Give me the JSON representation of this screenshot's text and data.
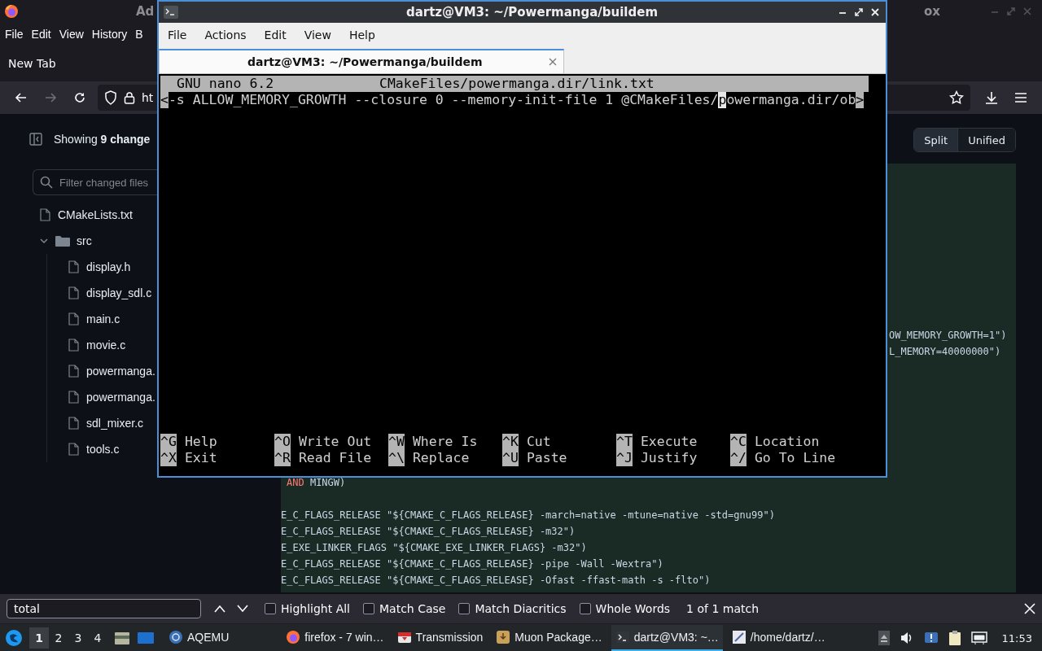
{
  "browser": {
    "title_left": "Ad",
    "title_right": "ox",
    "menu": [
      "File",
      "Edit",
      "View",
      "History",
      "B"
    ],
    "tab": "New Tab",
    "url": "ht"
  },
  "sidebar": {
    "summary": "Showing **9 change**",
    "filter": {
      "placeholder": "Filter changed files"
    },
    "tree": [
      {
        "kind": "file",
        "name": "CMakeLists.txt"
      },
      {
        "kind": "folder",
        "name": "src",
        "expanded": true,
        "children": [
          {
            "kind": "file",
            "name": "display.h"
          },
          {
            "kind": "file",
            "name": "display_sdl.c"
          },
          {
            "kind": "file",
            "name": "main.c"
          },
          {
            "kind": "file",
            "name": "movie.c"
          },
          {
            "kind": "file",
            "name": "powermanga."
          },
          {
            "kind": "file",
            "name": "powermanga."
          },
          {
            "kind": "file",
            "name": "sdl_mixer.c"
          },
          {
            "kind": "file",
            "name": "tools.c"
          }
        ]
      }
    ]
  },
  "view_toggle": [
    {
      "label": "Split",
      "selected": true
    },
    {
      "label": "Unified",
      "selected": false
    }
  ],
  "code": {
    "blocks": [
      [
        [
          {
            "kind": "plain",
            "text": "OW_MEMORY_GROWTH=1\")"
          }
        ],
        [
          {
            "kind": "plain",
            "text": "L_MEMORY=40000000\")"
          }
        ]
      ],
      [
        [
          {
            "kind": "keyword",
            "text": "AND"
          },
          {
            "kind": "plain",
            "text": " MINGW)"
          }
        ]
      ],
      [
        [
          {
            "kind": "plain",
            "text": "E_C_FLAGS_RELEASE \"${CMAKE_C_FLAGS_RELEASE} -march=native -mtune=native -std=gnu99\")"
          }
        ],
        [
          {
            "kind": "plain",
            "text": "E_C_FLAGS_RELEASE \"${CMAKE_C_FLAGS_RELEASE} -m32\")"
          }
        ],
        [
          {
            "kind": "plain",
            "text": "E_EXE_LINKER_FLAGS \"${CMAKE_EXE_LINKER_FLAGS} -m32\")"
          }
        ],
        [
          {
            "kind": "plain",
            "text": "E_C_FLAGS_RELEASE \"${CMAKE_C_FLAGS_RELEASE} -pipe -Wall -Wextra\")"
          }
        ],
        [
          {
            "kind": "plain",
            "text": "E_C_FLAGS_RELEASE \"${CMAKE_C_FLAGS_RELEASE} -Ofast -ffast-math -s -flto\")"
          }
        ]
      ]
    ]
  },
  "find_bar": {
    "value": "total",
    "options": [
      {
        "label": "Highlight All",
        "checked": false
      },
      {
        "label": "Match Case",
        "checked": false
      },
      {
        "label": "Match Diacritics",
        "checked": false
      },
      {
        "label": "Whole Words",
        "checked": false
      }
    ],
    "result": "1 of 1 match"
  },
  "terminal": {
    "title": "dartz@VM3: ~/Powermanga/buildem",
    "menu": [
      "File",
      "Actions",
      "Edit",
      "View",
      "Help"
    ],
    "tabs": [
      {
        "label": "dartz@VM3: ~/Powermanga/buildem",
        "selected": true
      }
    ],
    "nano": {
      "version": "GNU nano 6.2",
      "filename": "CMakeFiles/powermanga.dir/link.txt",
      "line": {
        "left_marker": "<",
        "before_cursor": "-s ALLOW_MEMORY_GROWTH --closure 0 --memory-init-file 1 @CMakeFiles/",
        "cursor": "p",
        "after_cursor": "owermanga.dir/ob",
        "right_marker": ">"
      },
      "shortcuts": [
        {
          "key": "^G",
          "label": "Help"
        },
        {
          "key": "^O",
          "label": "Write Out"
        },
        {
          "key": "^W",
          "label": "Where Is"
        },
        {
          "key": "^K",
          "label": "Cut"
        },
        {
          "key": "^T",
          "label": "Execute"
        },
        {
          "key": "^C",
          "label": "Location"
        },
        {
          "key": "^X",
          "label": "Exit"
        },
        {
          "key": "^R",
          "label": "Read File"
        },
        {
          "key": "^\\",
          "label": "Replace"
        },
        {
          "key": "^U",
          "label": "Paste"
        },
        {
          "key": "^J",
          "label": "Justify"
        },
        {
          "key": "^/",
          "label": "Go To Line"
        }
      ]
    }
  },
  "taskbar": {
    "workspaces": [
      {
        "label": "1",
        "selected": true
      },
      {
        "label": "2",
        "selected": false
      },
      {
        "label": "3",
        "selected": false
      },
      {
        "label": "4",
        "selected": false
      }
    ],
    "tasks": [
      {
        "kind": "emulator",
        "label": "AQEMU",
        "selected": false
      },
      {
        "kind": "browser",
        "label": "firefox - 7 win…",
        "selected": false
      },
      {
        "kind": "torrent",
        "label": "Transmission",
        "selected": false
      },
      {
        "kind": "package",
        "label": "Muon Package…",
        "selected": false
      },
      {
        "kind": "terminal",
        "label": "dartz@VM3: ~…",
        "selected": true
      },
      {
        "kind": "editor",
        "label": "/home/dartz/…",
        "selected": false
      }
    ],
    "clock": "11:53"
  }
}
